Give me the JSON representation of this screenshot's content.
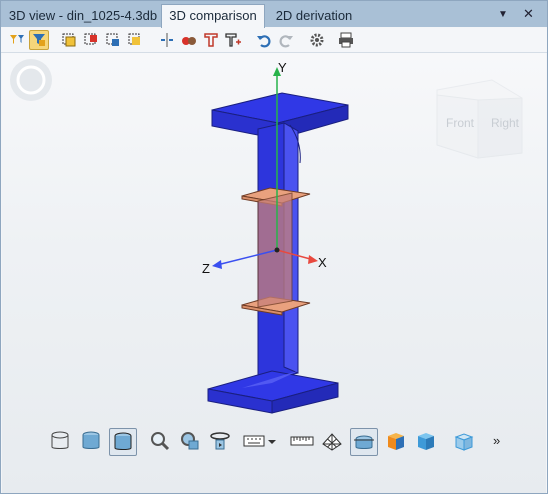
{
  "tabs": [
    {
      "label": "3D view - din_1025-4.3db",
      "active": false
    },
    {
      "label": "3D comparison",
      "active": true
    },
    {
      "label": "2D derivation",
      "active": false
    }
  ],
  "window_buttons": {
    "dropdown": "▼",
    "close": "✕"
  },
  "axes": {
    "x": "X",
    "y": "Y",
    "z": "Z"
  },
  "navcube": {
    "front": "Front",
    "right": "Right"
  },
  "more_label": "»",
  "colors": {
    "tab_bar": "#a9c0d6",
    "profile_blue": "#2f36e0",
    "plate_orange": "#e9a17e",
    "selected_tool": "#f5d67a"
  }
}
